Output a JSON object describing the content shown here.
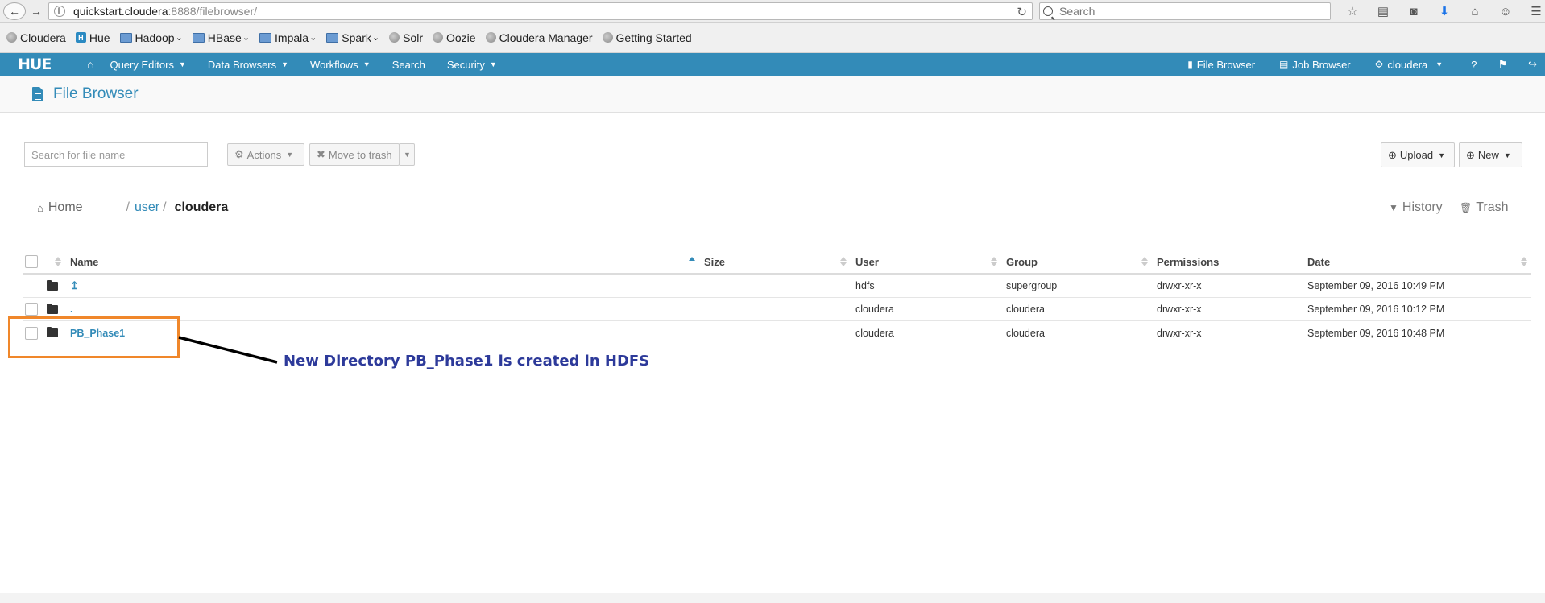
{
  "browser": {
    "url_host": "quickstart.cloudera",
    "url_rest": ":8888/filebrowser/",
    "search_placeholder": "Search",
    "icons": [
      "star-icon",
      "reading-list-icon",
      "pocket-icon",
      "download-icon",
      "home-icon",
      "chat-icon",
      "menu-icon"
    ]
  },
  "bookmarks": [
    {
      "label": "Cloudera",
      "icon": "globe-icon",
      "dropdown": false
    },
    {
      "label": "Hue",
      "icon": "hue-icon",
      "dropdown": false
    },
    {
      "label": "Hadoop",
      "icon": "folder-icon",
      "dropdown": true
    },
    {
      "label": "HBase",
      "icon": "folder-icon",
      "dropdown": true
    },
    {
      "label": "Impala",
      "icon": "folder-icon",
      "dropdown": true
    },
    {
      "label": "Spark",
      "icon": "folder-icon",
      "dropdown": true
    },
    {
      "label": "Solr",
      "icon": "globe-icon",
      "dropdown": false
    },
    {
      "label": "Oozie",
      "icon": "globe-icon",
      "dropdown": false
    },
    {
      "label": "Cloudera Manager",
      "icon": "globe-icon",
      "dropdown": false
    },
    {
      "label": "Getting Started",
      "icon": "globe-icon",
      "dropdown": false
    }
  ],
  "hue_nav": {
    "logo": "HUE",
    "menus": [
      "Query Editors",
      "Data Browsers",
      "Workflows",
      "Search",
      "Security"
    ],
    "file_browser": "File Browser",
    "job_browser": "Job Browser",
    "user": "cloudera",
    "color": "#338bb8"
  },
  "page": {
    "title": "File Browser"
  },
  "toolbar": {
    "search_placeholder": "Search for file name",
    "actions_label": "Actions",
    "move_to_trash_label": "Move to trash",
    "upload_label": "Upload",
    "new_label": "New"
  },
  "breadcrumb": {
    "home": "Home",
    "sep": "/",
    "user": "user",
    "current": "cloudera",
    "history": "History",
    "trash": "Trash"
  },
  "table": {
    "headers": {
      "name": "Name",
      "size": "Size",
      "user": "User",
      "group": "Group",
      "permissions": "Permissions",
      "date": "Date"
    },
    "rows": [
      {
        "name": "↥",
        "size": "",
        "user": "hdfs",
        "group": "supergroup",
        "permissions": "drwxr-xr-x",
        "date": "September 09, 2016 10:49 PM"
      },
      {
        "name": ".",
        "size": "",
        "user": "cloudera",
        "group": "cloudera",
        "permissions": "drwxr-xr-x",
        "date": "September 09, 2016 10:12 PM"
      },
      {
        "name": "PB_Phase1",
        "size": "",
        "user": "cloudera",
        "group": "cloudera",
        "permissions": "drwxr-xr-x",
        "date": "September 09, 2016 10:48 PM"
      }
    ]
  },
  "annotation": {
    "text": "New Directory PB_Phase1 is created in HDFS",
    "box_color": "#f0872a",
    "text_color": "#2d3a9a"
  }
}
